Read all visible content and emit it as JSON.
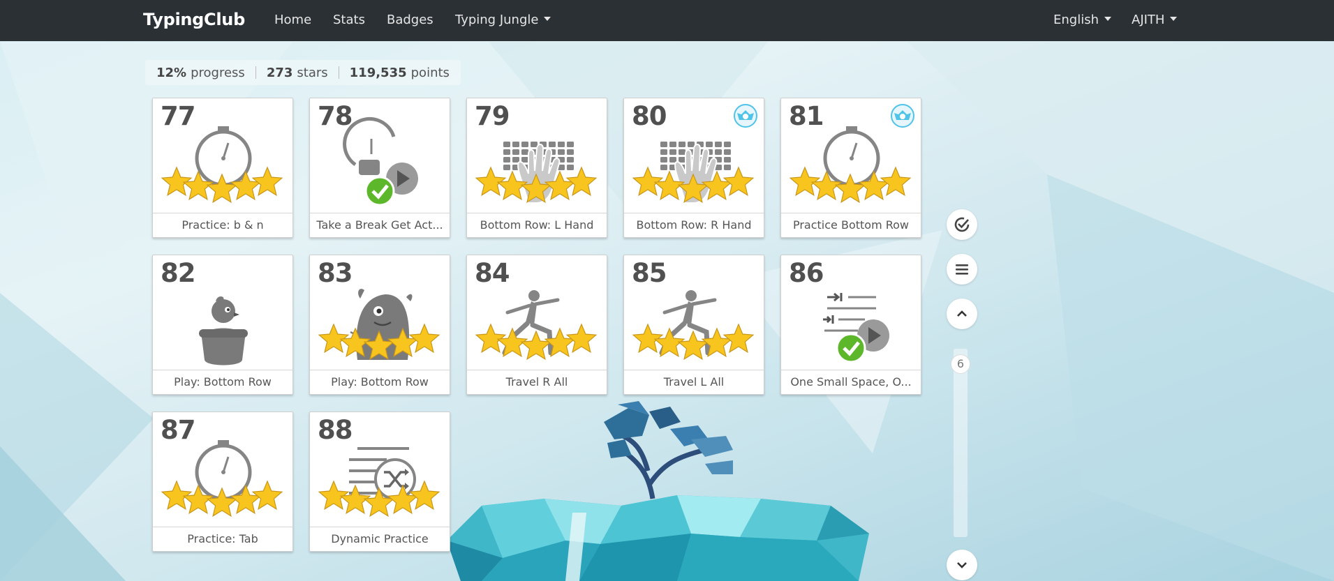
{
  "navbar": {
    "brand": "TypingClub",
    "links": [
      "Home",
      "Stats",
      "Badges",
      "Typing Jungle"
    ],
    "language": "English",
    "user": "AJITH"
  },
  "stats": {
    "progress_value": "12%",
    "progress_label": "progress",
    "stars_value": "273",
    "stars_label": "stars",
    "points_value": "119,535",
    "points_label": "points"
  },
  "lessons": [
    {
      "num": "77",
      "title": "Practice: b & n",
      "icon": "stopwatch-icon",
      "stars": 5,
      "badge": false
    },
    {
      "num": "78",
      "title": "Take a Break Get Act...",
      "icon": "coffee-break-icon",
      "stars": 0,
      "completed": true,
      "badge": false
    },
    {
      "num": "79",
      "title": "Bottom Row: L Hand",
      "icon": "keyboard-hand-icon",
      "stars": 5,
      "badge": false
    },
    {
      "num": "80",
      "title": "Bottom Row: R Hand",
      "icon": "keyboard-hand-icon",
      "stars": 5,
      "badge": true
    },
    {
      "num": "81",
      "title": "Practice Bottom Row",
      "icon": "stopwatch-icon",
      "stars": 5,
      "badge": true
    },
    {
      "num": "82",
      "title": "Play: Bottom Row",
      "icon": "bird-pot-icon",
      "stars": 0,
      "badge": false
    },
    {
      "num": "83",
      "title": "Play: Bottom Row",
      "icon": "monster-icon",
      "stars": 5,
      "badge": false
    },
    {
      "num": "84",
      "title": "Travel R All",
      "icon": "yoga-icon",
      "stars": 5,
      "badge": false
    },
    {
      "num": "85",
      "title": "Travel L All",
      "icon": "yoga-icon",
      "stars": 5,
      "badge": false
    },
    {
      "num": "86",
      "title": "One Small Space, O...",
      "icon": "tab-keys-icon",
      "stars": 0,
      "completed": true,
      "badge": false
    },
    {
      "num": "87",
      "title": "Practice: Tab",
      "icon": "stopwatch-icon",
      "stars": 5,
      "badge": false
    },
    {
      "num": "88",
      "title": "Dynamic Practice",
      "icon": "shuffle-list-icon",
      "stars": 5,
      "badge": false
    }
  ],
  "controls": {
    "scroll_position": "6"
  },
  "colors": {
    "navbar_bg": "#2b3035",
    "star_gold": "#f7c51d",
    "check_green": "#5cb82a",
    "badge_blue": "#4fc3e8"
  }
}
